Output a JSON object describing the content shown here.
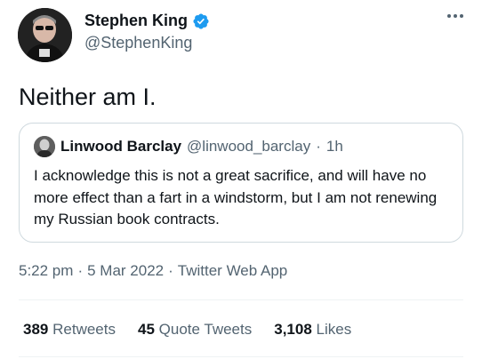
{
  "tweet": {
    "author": {
      "name": "Stephen King",
      "handle": "@StephenKing",
      "verified": true
    },
    "text": "Neither am I.",
    "quoted": {
      "author": {
        "name": "Linwood Barclay",
        "handle": "@linwood_barclay"
      },
      "separator": "·",
      "time": "1h",
      "text": "I acknowledge this is not a great sacrifice, and will have no more effect than a fart in a windstorm, but I am not renewing my Russian book contracts."
    },
    "meta": {
      "time": "5:22 pm",
      "separator": "·",
      "date": "5 Mar 2022",
      "source": "Twitter Web App"
    },
    "stats": [
      {
        "count": "389",
        "label": "Retweets"
      },
      {
        "count": "45",
        "label": "Quote Tweets"
      },
      {
        "count": "3,108",
        "label": "Likes"
      }
    ]
  },
  "colors": {
    "verified": "#1d9bf0",
    "secondary_text": "#536471",
    "border": "#cfd9de"
  },
  "icons": {
    "verified": "verified-badge-icon",
    "more": "more-options-icon"
  }
}
